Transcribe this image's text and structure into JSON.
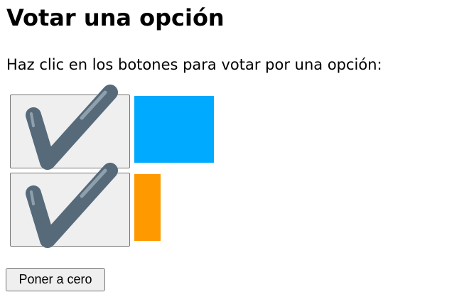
{
  "header": {
    "title": "Votar una opción"
  },
  "instructions": "Haz clic en los botones para votar por una opción:",
  "options": [
    {
      "icon": "checkmark-icon",
      "bar_color": "#00aaff",
      "bar_fraction": 1.0
    },
    {
      "icon": "checkmark-icon",
      "bar_color": "#ff9900",
      "bar_fraction": 0.33
    }
  ],
  "colors": {
    "check_stroke": "#566a7a",
    "check_highlight": "#8fa0ad",
    "button_bg": "#efefef"
  },
  "reset_button": {
    "label": "Poner a cero"
  }
}
